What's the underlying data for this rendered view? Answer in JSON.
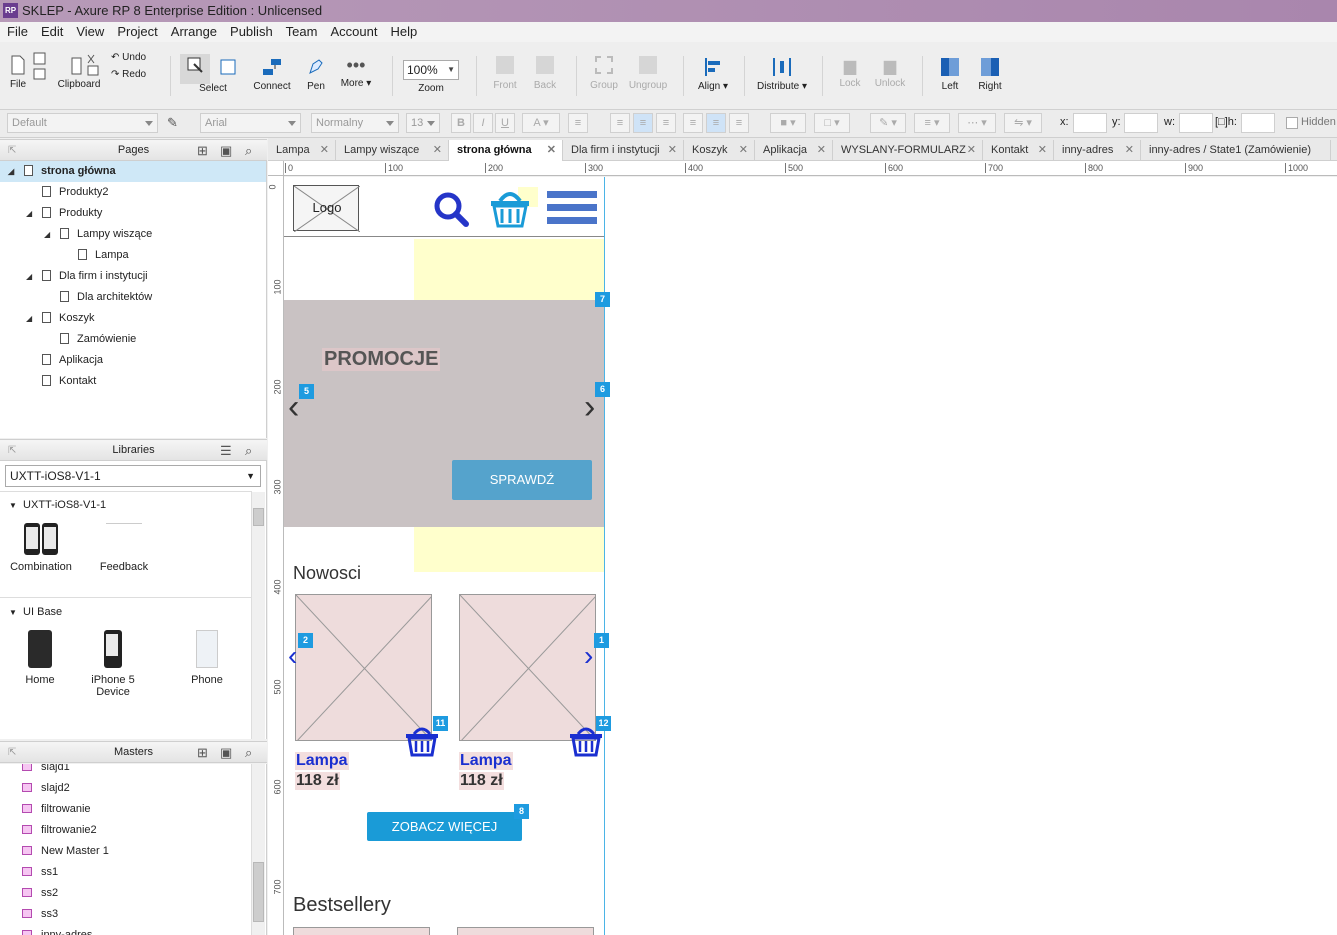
{
  "window": {
    "title": "SKLEP - Axure RP 8 Enterprise Edition : Unlicensed",
    "app_badge": "RP"
  },
  "menu": [
    "File",
    "Edit",
    "View",
    "Project",
    "Arrange",
    "Publish",
    "Team",
    "Account",
    "Help"
  ],
  "toolbar": {
    "file": "File",
    "clipboard": "Clipboard",
    "undo": "Undo",
    "redo": "Redo",
    "select": "Select",
    "connect": "Connect",
    "pen": "Pen",
    "more": "More ▾",
    "zoom_value": "100%",
    "zoom": "Zoom",
    "front": "Front",
    "back": "Back",
    "group": "Group",
    "ungroup": "Ungroup",
    "align": "Align ▾",
    "distribute": "Distribute ▾",
    "lock": "Lock",
    "unlock": "Unlock",
    "left": "Left",
    "right": "Right"
  },
  "format": {
    "style": "Default",
    "font": "Arial",
    "weight": "Normalny",
    "size": "13",
    "x_label": "x:",
    "y_label": "y:",
    "w_label": "w:",
    "h_label": "h:",
    "hidden": "Hidden"
  },
  "pages_panel": {
    "title": "Pages",
    "items": [
      {
        "label": "strona główna",
        "level": 0,
        "expanded": true,
        "selected": true
      },
      {
        "label": "Produkty2",
        "level": 1
      },
      {
        "label": "Produkty",
        "level": 1,
        "expanded": true
      },
      {
        "label": "Lampy wiszące",
        "level": 2,
        "expanded": true
      },
      {
        "label": "Lampa",
        "level": 3
      },
      {
        "label": "Dla firm i instytucji",
        "level": 1,
        "expanded": true
      },
      {
        "label": "Dla architektów",
        "level": 2
      },
      {
        "label": "Koszyk",
        "level": 1,
        "expanded": true
      },
      {
        "label": "Zamówienie",
        "level": 2
      },
      {
        "label": "Aplikacja",
        "level": 1
      },
      {
        "label": "Kontakt",
        "level": 1
      }
    ]
  },
  "libraries_panel": {
    "title": "Libraries",
    "selected": "UXTT-iOS8-V1-1",
    "groups": [
      {
        "name": "UXTT-iOS8-V1-1",
        "items": [
          "Combination",
          "Feedback"
        ]
      },
      {
        "name": "UI Base",
        "items": [
          "Home",
          "iPhone 5 Device",
          "Phone"
        ]
      }
    ]
  },
  "masters_panel": {
    "title": "Masters",
    "items": [
      "slajd1",
      "slajd2",
      "filtrowanie",
      "filtrowanie2",
      "New Master 1",
      "ss1",
      "ss2",
      "ss3",
      "inny-adres"
    ]
  },
  "tabs": [
    {
      "label": "Lampa"
    },
    {
      "label": "Lampy wiszące"
    },
    {
      "label": "strona główna",
      "active": true
    },
    {
      "label": "Dla firm i instytucji"
    },
    {
      "label": "Koszyk"
    },
    {
      "label": "Aplikacja"
    },
    {
      "label": "WYSLANY-FORMULARZ"
    },
    {
      "label": "Kontakt"
    },
    {
      "label": "inny-adres"
    },
    {
      "label": "inny-adres / State1 (Zamówienie)"
    }
  ],
  "ruler": {
    "h_ticks": [
      "0",
      "100",
      "200",
      "300",
      "400",
      "500",
      "600",
      "700",
      "800",
      "900",
      "1000"
    ],
    "v_ticks": [
      "0",
      "100",
      "200",
      "300",
      "400",
      "500",
      "600",
      "700"
    ]
  },
  "wireframe": {
    "logo": "Logo",
    "promo_title": "PROMOCJE",
    "promo_button": "SPRAWDŹ",
    "new_heading": "Nowosci",
    "products": [
      {
        "name": "Lampa",
        "price": "118 zł"
      },
      {
        "name": "Lampa",
        "price": "118 zł"
      }
    ],
    "more_button": "ZOBACZ WIĘCEJ",
    "best_heading": "Bestsellery",
    "markers": [
      "1",
      "2",
      "5",
      "6",
      "7",
      "8",
      "11",
      "12"
    ]
  },
  "colors": {
    "accent": "#1a9bd7",
    "icon_blue": "#2535c8",
    "promo_bg": "#c9c2c3",
    "placeholder_bg": "#eedcdc",
    "yellow": "#ffffcc"
  }
}
